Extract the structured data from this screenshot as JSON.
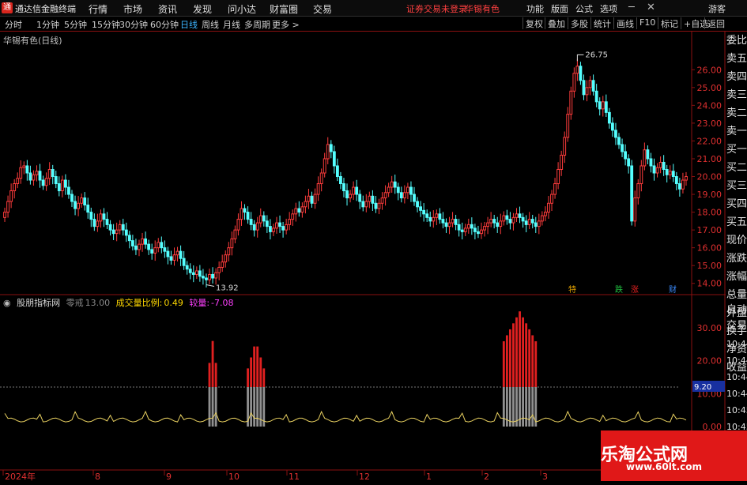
{
  "topbar": {
    "logo": "通",
    "app_name": "通达信金融终端",
    "menus": [
      "行情",
      "市场",
      "资讯",
      "发现",
      "问小达",
      "财富圈",
      "交易"
    ],
    "notice": "证券交易未登录",
    "stock": "华锡有色",
    "right_menus": [
      "功能",
      "版面",
      "公式",
      "选项"
    ],
    "user": "游客"
  },
  "periodbar": {
    "items": [
      "分时",
      "1分钟",
      "5分钟",
      "15分钟",
      "30分钟",
      "60分钟",
      "日线",
      "周线",
      "月线",
      "多周期",
      "更多 >"
    ],
    "active": "日线",
    "right_items": [
      "复权",
      "叠加",
      "多股",
      "统计",
      "画线",
      "F10",
      "标记",
      "+自选",
      "返回"
    ]
  },
  "chart_title": "华锡有色(日线)",
  "price_axis": [
    "26.00",
    "25.00",
    "24.00",
    "23.00",
    "22.00",
    "21.00",
    "20.00",
    "19.00",
    "18.00",
    "17.00",
    "16.00",
    "15.00",
    "14.00"
  ],
  "annotations": {
    "high": "26.75",
    "low": "13.92"
  },
  "event_tags": [
    {
      "text": "特",
      "color": "#e0a000"
    },
    {
      "text": "跌",
      "color": "#20c040"
    },
    {
      "text": "涨",
      "color": "#e02020"
    },
    {
      "text": "财",
      "color": "#3c8cff"
    }
  ],
  "sidebar": [
    "委比",
    "卖五",
    "卖四",
    "卖三",
    "卖二",
    "卖一",
    "买一",
    "买二",
    "买三",
    "买四",
    "买五",
    "现价",
    "涨跌",
    "涨幅",
    "总量",
    "外盘",
    "换手",
    "净资",
    "收益"
  ],
  "sidebar2": [
    "自动",
    "交易"
  ],
  "sidebar3": [
    "10:44",
    "10:44",
    "10:44",
    "10:44",
    "10:45",
    "10:45",
    "10:45",
    "10:45",
    "10:45"
  ],
  "indicator": {
    "name": "股朋指标网",
    "param_label": "零戒",
    "param_value": "13.00",
    "ratio_label": "成交量比例:",
    "ratio_value": "0.49",
    "vol_label": "较量:",
    "vol_value": "-7.08"
  },
  "indicator_axis": [
    "30.00",
    "20.00",
    "10.00",
    "0.00"
  ],
  "indicator_marker": "9.20",
  "date_axis": [
    "2024年",
    "8",
    "9",
    "10",
    "11",
    "12",
    "1",
    "2",
    "3"
  ],
  "watermark": "乐淘公式网",
  "watermark_url": "www.60lt.com",
  "chart_data": {
    "type": "candlestick",
    "title": "华锡有色(日线)",
    "ylim": [
      13.5,
      26.9
    ],
    "close": [
      18.0,
      18.6,
      19.2,
      19.6,
      19.9,
      20.5,
      20.6,
      20.2,
      19.8,
      20.1,
      20.3,
      19.8,
      19.5,
      19.9,
      20.4,
      20.0,
      19.6,
      19.2,
      19.8,
      19.4,
      19.0,
      18.6,
      18.2,
      18.5,
      18.8,
      18.4,
      18.0,
      17.6,
      17.2,
      17.5,
      17.9,
      17.6,
      17.3,
      17.0,
      16.8,
      17.0,
      17.3,
      17.0,
      16.7,
      16.4,
      16.1,
      15.9,
      16.2,
      16.5,
      16.2,
      15.9,
      15.7,
      16.0,
      16.3,
      16.0,
      15.8,
      15.5,
      15.3,
      15.6,
      15.8,
      15.4,
      15.0,
      14.8,
      14.6,
      14.5,
      14.7,
      14.4,
      14.3,
      14.2,
      14.5,
      14.3,
      14.6,
      14.9,
      15.2,
      15.6,
      16.0,
      16.5,
      17.0,
      17.6,
      18.2,
      18.0,
      17.6,
      17.3,
      17.0,
      17.4,
      17.8,
      17.5,
      17.2,
      16.9,
      17.1,
      17.4,
      17.2,
      17.0,
      17.3,
      17.6,
      17.9,
      18.2,
      18.0,
      18.3,
      18.6,
      18.9,
      18.5,
      19.0,
      19.6,
      20.2,
      21.0,
      21.8,
      21.4,
      20.6,
      20.0,
      19.6,
      19.2,
      18.8,
      19.0,
      19.4,
      19.0,
      18.6,
      18.3,
      18.6,
      18.9,
      18.5,
      18.2,
      18.5,
      18.8,
      19.1,
      19.4,
      19.7,
      19.4,
      19.1,
      18.8,
      19.1,
      19.4,
      19.0,
      18.6,
      18.3,
      18.1,
      17.9,
      17.7,
      17.5,
      17.7,
      17.9,
      17.6,
      17.4,
      17.2,
      17.4,
      17.6,
      17.3,
      17.0,
      16.9,
      17.1,
      17.3,
      17.1,
      16.9,
      16.8,
      17.0,
      17.2,
      17.4,
      17.6,
      17.4,
      17.2,
      17.5,
      17.8,
      17.6,
      17.4,
      17.7,
      17.9,
      17.7,
      17.5,
      17.3,
      17.6,
      17.4,
      17.2,
      17.5,
      17.8,
      18.0,
      18.5,
      19.0,
      19.6,
      20.4,
      21.2,
      22.2,
      23.5,
      24.8,
      25.8,
      26.2,
      25.4,
      24.6,
      25.0,
      25.4,
      24.8,
      24.2,
      23.8,
      24.2,
      23.6,
      23.0,
      22.6,
      22.2,
      21.8,
      21.4,
      21.0,
      20.6,
      17.5,
      18.8,
      19.6,
      20.6,
      21.5,
      21.0,
      20.6,
      20.2,
      20.5,
      20.8,
      20.4,
      20.1,
      20.3,
      20.0,
      19.6,
      19.3,
      19.8,
      20.0
    ],
    "extremes": {
      "high": 26.75,
      "low": 13.92
    },
    "indicator_series": {
      "name": "成交量比例",
      "levels": [
        30,
        20,
        10,
        0
      ]
    }
  },
  "colors": {
    "up": "#ff3c3c",
    "down": "#54ffff",
    "bg": "#000000",
    "grid": "#8a1010",
    "accent": "#3cb4ff"
  }
}
